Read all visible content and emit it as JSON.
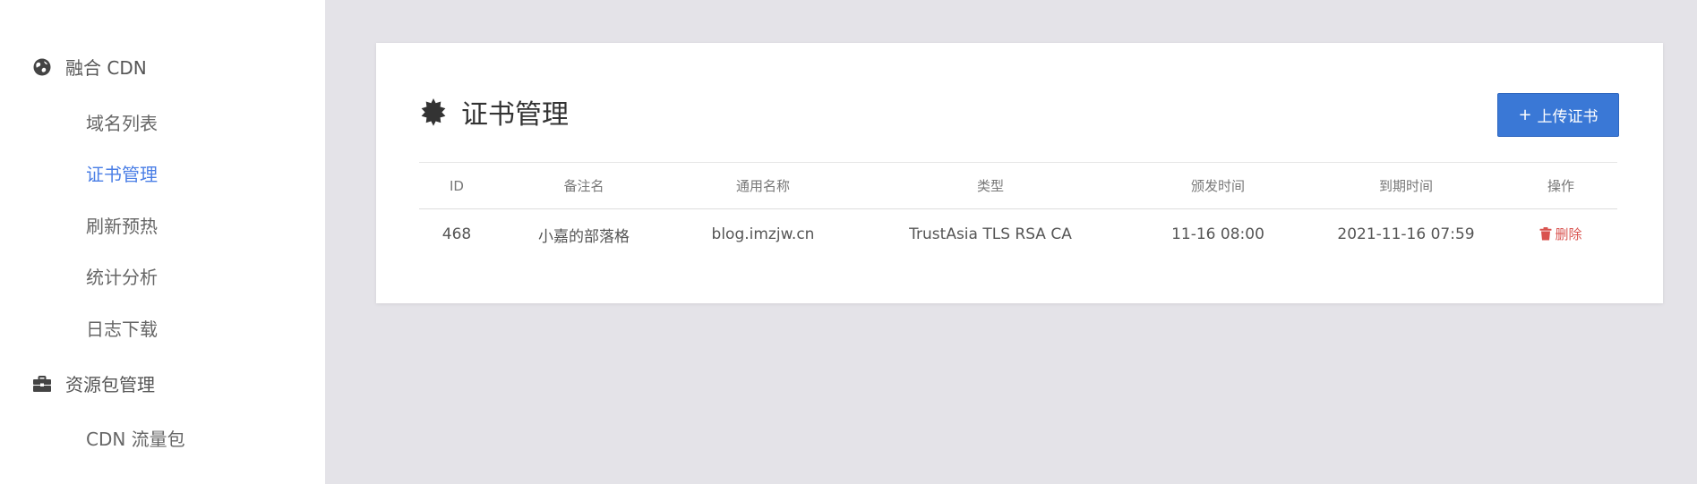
{
  "sidebar": {
    "groups": [
      {
        "label": "融合 CDN",
        "icon": "globe-icon"
      },
      {
        "label": "资源包管理",
        "icon": "briefcase-icon"
      }
    ],
    "cdn_items": [
      {
        "label": "域名列表",
        "active": false
      },
      {
        "label": "证书管理",
        "active": true
      },
      {
        "label": "刷新预热",
        "active": false
      },
      {
        "label": "统计分析",
        "active": false
      },
      {
        "label": "日志下载",
        "active": false
      }
    ],
    "package_items": [
      {
        "label": "CDN 流量包",
        "active": false
      }
    ]
  },
  "page": {
    "title": "证书管理",
    "title_icon": "certificate-icon",
    "upload_button": {
      "plus": "+",
      "label": "上传证书"
    }
  },
  "table": {
    "columns": [
      "ID",
      "备注名",
      "通用名称",
      "类型",
      "颁发时间",
      "到期时间",
      "操作"
    ],
    "rows": [
      {
        "id": "468",
        "remark": "小嘉的部落格",
        "common_name": "blog.imzjw.cn",
        "type": "TrustAsia TLS RSA CA",
        "issued": "11-16 08:00",
        "expires": "2021-11-16 07:59",
        "action": "删除"
      }
    ]
  },
  "colors": {
    "accent": "#4a7ee6",
    "primary_button": "#3a78d6",
    "danger": "#d9534f",
    "background": "#e4e3e8"
  }
}
